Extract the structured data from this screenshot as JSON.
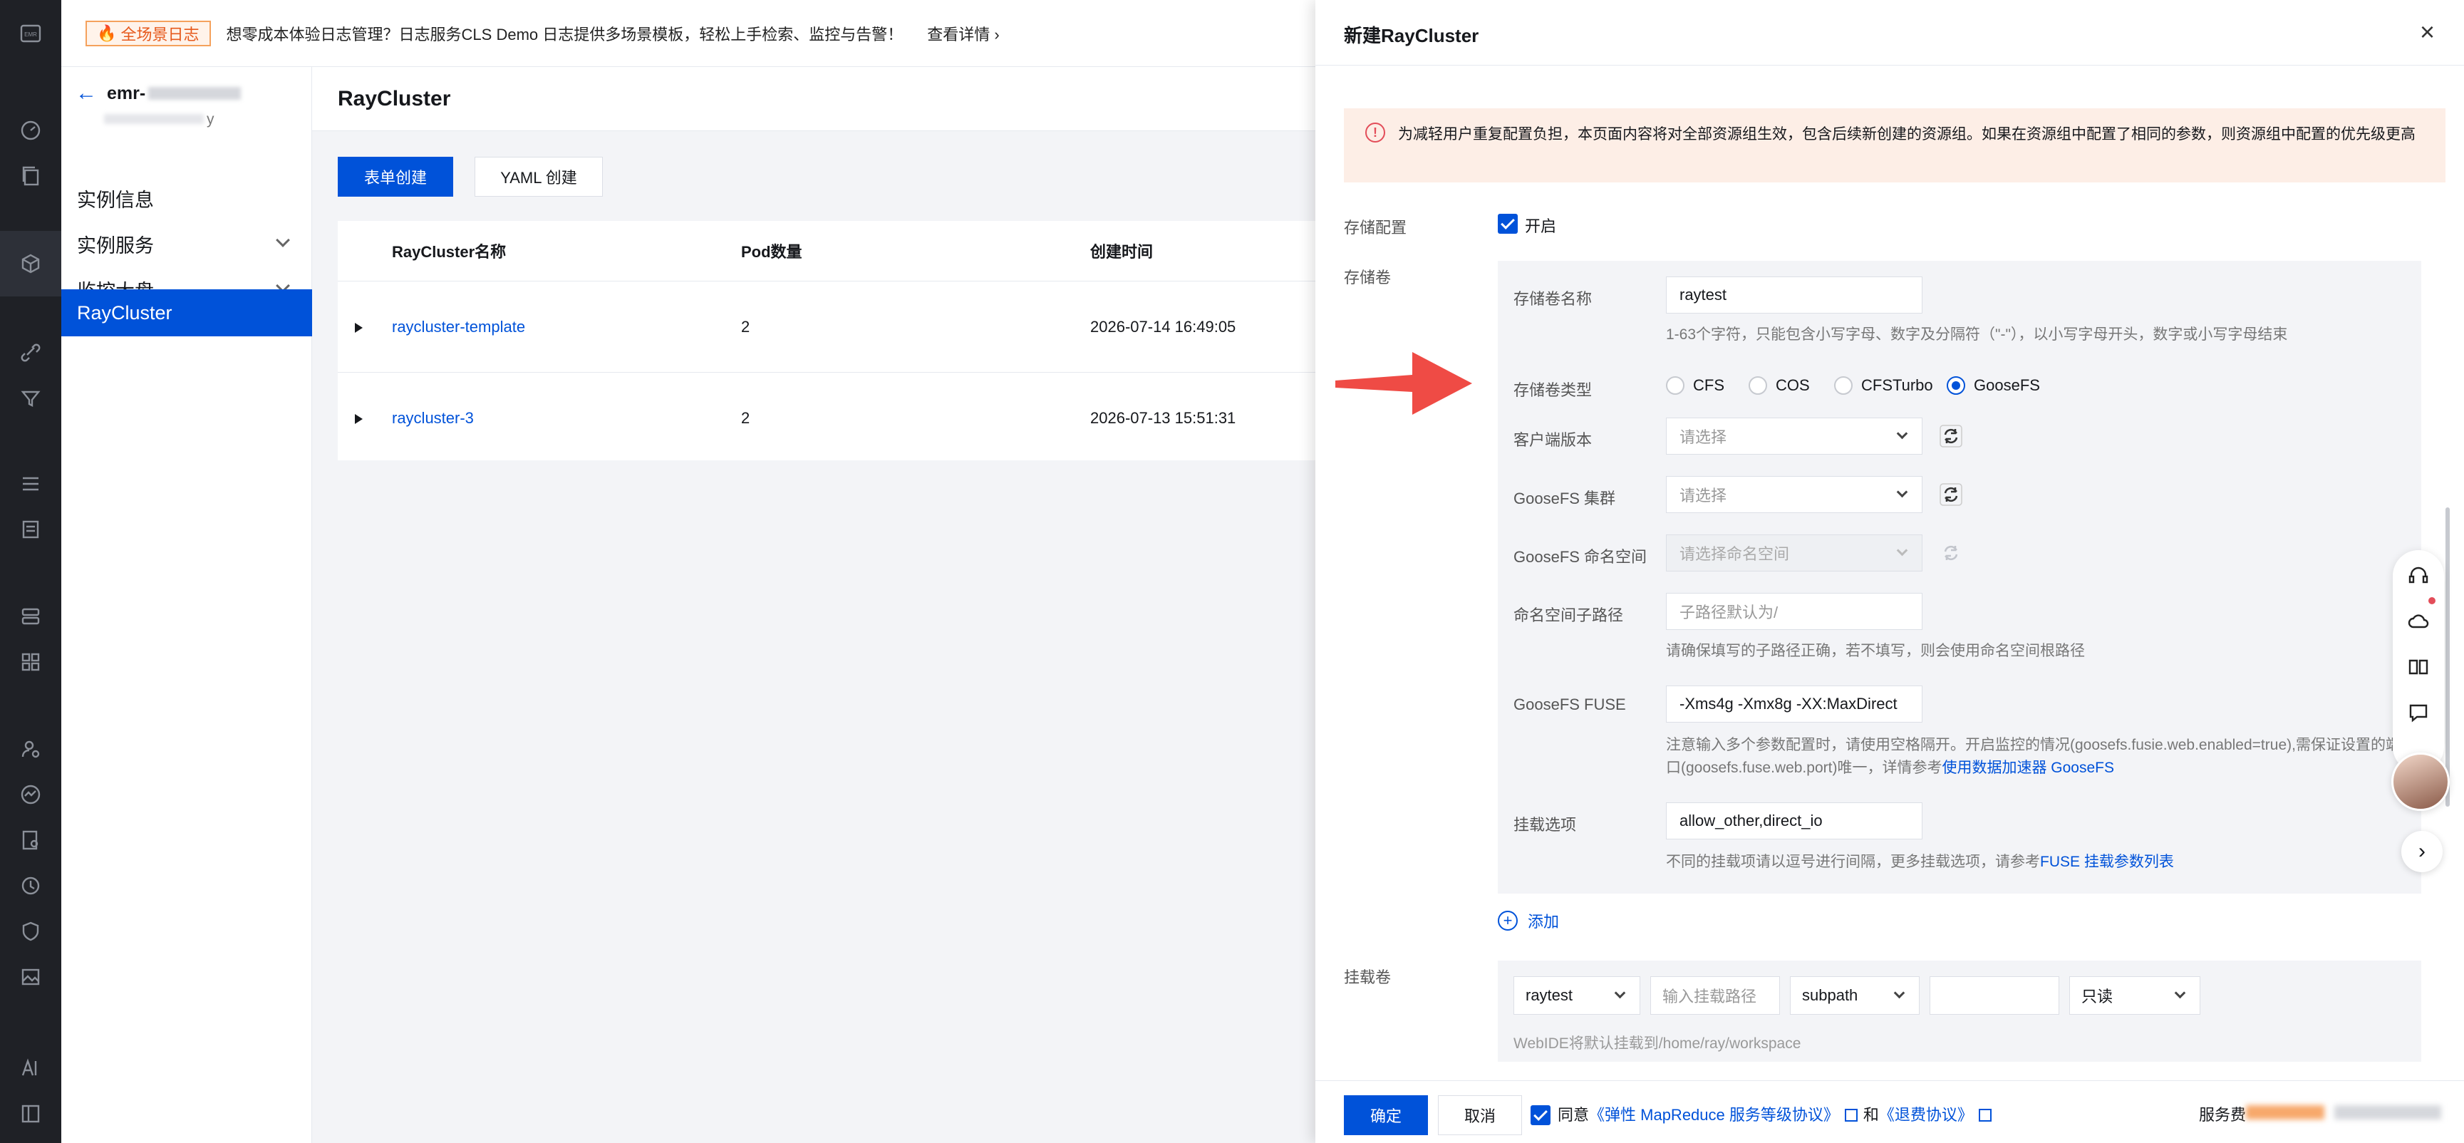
{
  "rail": {
    "logo": "EMR"
  },
  "banner": {
    "tag": "全场景日志",
    "text": "想零成本体验日志管理？日志服务CLS Demo 日志提供多场景模板，轻松上手检索、监控与告警！",
    "link": "查看详情 ›"
  },
  "subnav": {
    "instance_name": "emr-",
    "instance_sub": "y",
    "items": [
      {
        "label": "实例信息"
      },
      {
        "label": "实例服务"
      },
      {
        "label": "监控大盘"
      },
      {
        "label": "RayCluster"
      }
    ]
  },
  "main": {
    "title": "RayCluster",
    "form_create": "表单创建",
    "yaml_create": "YAML 创建",
    "columns": [
      "RayCluster名称",
      "Pod数量",
      "创建时间"
    ],
    "rows": [
      {
        "name": "raycluster-template",
        "pods": "2",
        "created": "2026-07-14 16:49:05"
      },
      {
        "name": "raycluster-3",
        "pods": "2",
        "created": "2026-07-13 15:51:31"
      }
    ]
  },
  "drawer": {
    "title": "新建RayCluster",
    "close": "×",
    "notice": "为减轻用户重复配置负担，本页面内容将对全部资源组生效，包含后续新创建的资源组。如果在资源组中配置了相同的参数，则资源组中配置的优先级更高",
    "storage_config_label": "存储配置",
    "storage_config_value": "开启",
    "storage_volume_label": "存储卷",
    "volume": {
      "name_label": "存储卷名称",
      "name_value": "raytest",
      "name_help": "1-63个字符，只能包含小写字母、数字及分隔符（\"-\"），以小写字母开头，数字或小写字母结束",
      "type_label": "存储卷类型",
      "types": [
        "CFS",
        "COS",
        "CFSTurbo",
        "GooseFS"
      ],
      "selected_type": "GooseFS",
      "client_label": "客户端版本",
      "client_placeholder": "请选择",
      "cluster_label": "GooseFS 集群",
      "cluster_placeholder": "请选择",
      "namespace_label": "GooseFS 命名空间",
      "namespace_placeholder": "请选择命名空间",
      "subpath_label": "命名空间子路径",
      "subpath_placeholder": "子路径默认为/",
      "subpath_help": "请确保填写的子路径正确，若不填写，则会使用命名空间根路径",
      "fuse_label": "GooseFS FUSE",
      "fuse_value": "-Xms4g -Xmx8g -XX:MaxDirect",
      "fuse_help": "注意输入多个参数配置时，请使用空格隔开。开启监控的情况(goosefs.fusie.web.enabled=true),需保证设置的端口(goosefs.fuse.web.port)唯一，详情参考",
      "fuse_help_link": "使用数据加速器 GooseFS",
      "mount_opt_label": "挂载选项",
      "mount_opt_value": "allow_other,direct_io",
      "mount_opt_help": "不同的挂载项请以逗号进行间隔，更多挂载选项，请参考",
      "mount_opt_help_link": "FUSE 挂载参数列表"
    },
    "add_label": "添加",
    "mount_label": "挂载卷",
    "mount": {
      "volume": "raytest",
      "path_placeholder": "输入挂载路径",
      "subpath": "subpath",
      "subpath_value": "",
      "mode": "只读",
      "hint": "WebIDE将默认挂载到/home/ray/workspace"
    },
    "footer": {
      "confirm": "确定",
      "cancel": "取消",
      "agree": "同意",
      "agreement1": "《弹性 MapReduce 服务等级协议》",
      "and": "和",
      "agreement2": "《退费协议》",
      "fee_label": "服务费"
    }
  },
  "colors": {
    "primary": "#0052d9",
    "rail": "#1f2126",
    "warn_bg": "#fdeee6"
  }
}
